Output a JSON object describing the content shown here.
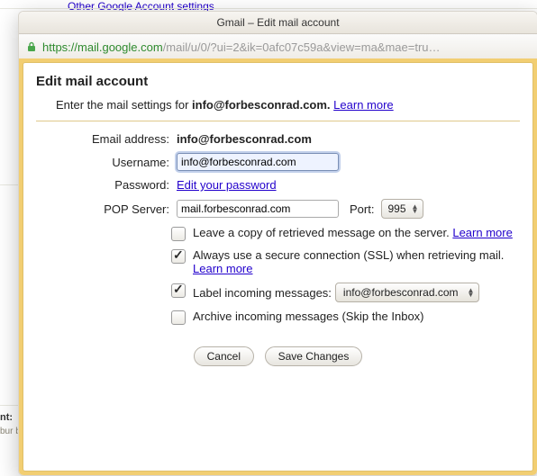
{
  "behind_link": "Other Google Account settings",
  "bg_label": "nt:",
  "bg_sub": "bur be",
  "window_title": "Gmail – Edit mail account",
  "url": {
    "secure_part": "https://mail.google.com",
    "rest_part": "/mail/u/0/?ui=2&ik=0afc07c59a&view=ma&mae=tru…"
  },
  "dialog_title": "Edit mail account",
  "intro_prefix": "Enter the mail settings for ",
  "intro_bold": "info@forbesconrad.com.",
  "learn_more": "Learn more",
  "labels": {
    "email": "Email address:",
    "username": "Username:",
    "password": "Password:",
    "pop": "POP Server:",
    "port": "Port:"
  },
  "values": {
    "email": "info@forbesconrad.com",
    "username_value": "info@forbesconrad.com",
    "password_link": "Edit your password",
    "pop_value": "mail.forbesconrad.com",
    "port_value": "995"
  },
  "options": {
    "leave_copy": "Leave a copy of retrieved message on the server.",
    "ssl": "Always use a secure connection (SSL) when retrieving mail.",
    "label_incoming": "Label incoming messages:",
    "label_value": "info@forbesconrad.com",
    "archive": "Archive incoming messages (Skip the Inbox)"
  },
  "buttons": {
    "cancel": "Cancel",
    "save": "Save Changes"
  }
}
